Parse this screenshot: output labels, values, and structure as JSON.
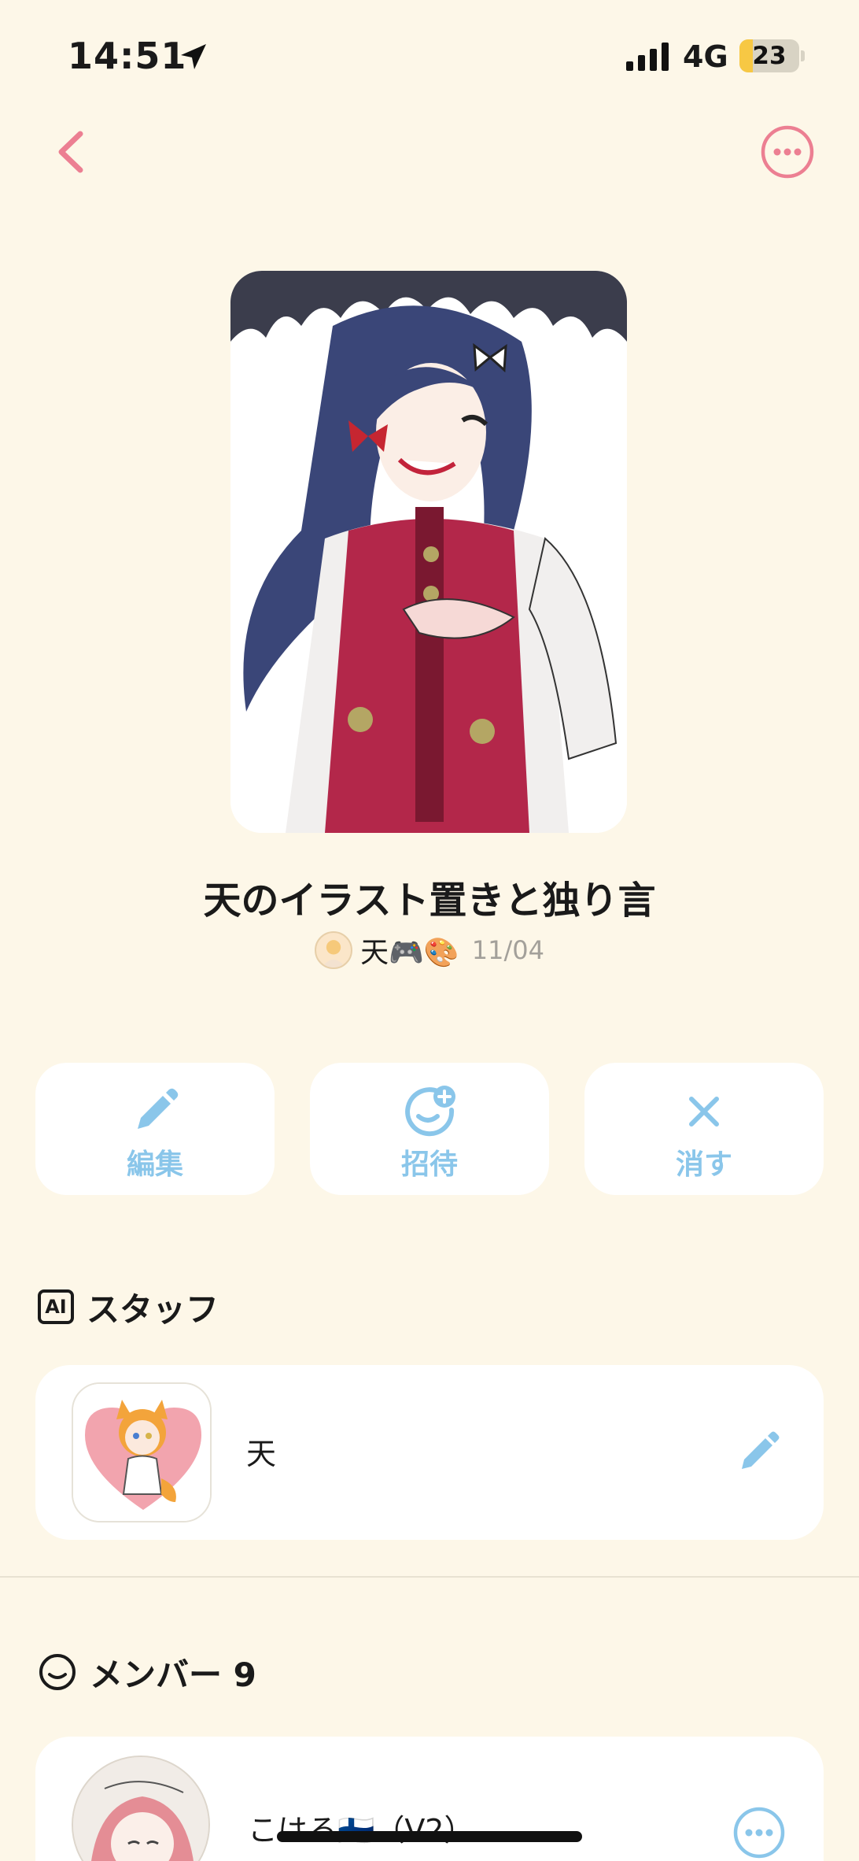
{
  "status_bar": {
    "time": "14:51",
    "network": "4G",
    "battery": "23",
    "battery_level": 0.23
  },
  "nav": {
    "back_icon": "chevron-left-icon",
    "more_icon": "ellipsis-circle-icon"
  },
  "group": {
    "title": "天のイラスト置きと独り言",
    "owner": "天🎮🎨",
    "date": "11/04"
  },
  "actions": [
    {
      "label": "編集",
      "icon": "pencil-icon"
    },
    {
      "label": "招待",
      "icon": "add-person-icon"
    },
    {
      "label": "消す",
      "icon": "close-icon"
    }
  ],
  "staff": {
    "icon_text": "AI",
    "heading": "スタッフ",
    "members": [
      {
        "name": "天"
      }
    ]
  },
  "members": {
    "heading": "メンバー 9",
    "items": [
      {
        "name": "こはる🇫🇮（V2）"
      }
    ]
  },
  "colors": {
    "accent_pink": "#ec7f92",
    "accent_blue": "#8ac6ea",
    "background": "#fdf7e8"
  }
}
